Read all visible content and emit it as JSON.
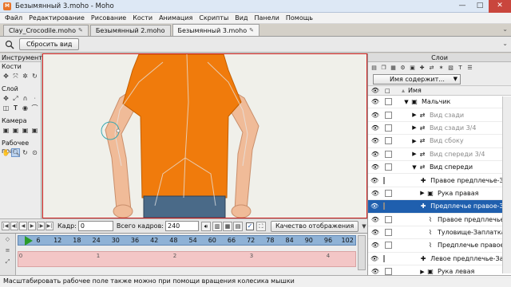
{
  "window": {
    "title": "Безымянный 3.moho - Moho",
    "logo_text": "M"
  },
  "menu": [
    "Файл",
    "Редактирование",
    "Рисование",
    "Кости",
    "Анимация",
    "Скрипты",
    "Вид",
    "Панели",
    "Помощь"
  ],
  "tabs": [
    {
      "label": "Clay_Crocodile.moho"
    },
    {
      "label": "Безымянный 2.moho"
    },
    {
      "label": "Безымянный 3.moho"
    }
  ],
  "toolbar": {
    "reset_view_label": "Сбросить вид"
  },
  "tools": {
    "header": "Инструменты",
    "groups": [
      {
        "label": "Кости",
        "icons": [
          "bone-select-icon",
          "bone-translate-icon",
          "bone-scale-icon",
          "bone-rotate-icon"
        ]
      },
      {
        "label": "Слой",
        "icons": [
          "layer-translate-icon",
          "layer-scale-icon",
          "layer-rotate-icon",
          "layer-shear-icon",
          "layer-flip-icon",
          "layer-text-icon",
          "layer-eye-icon",
          "layer-curve-icon"
        ]
      },
      {
        "label": "Камера",
        "icons": [
          "camera-track-icon",
          "camera-zoom-icon",
          "camera-roll-icon",
          "camera-pan-icon"
        ]
      },
      {
        "label": "Рабочее поле",
        "icons": [
          "hand-pan-icon",
          "zoom-tool-icon",
          "rotate-view-icon",
          "orbit-icon"
        ]
      }
    ]
  },
  "playbar": {
    "frame_label": "Кадр:",
    "frame_value": "0",
    "total_label": "Всего кадров:",
    "total_value": "240",
    "check_mark": "✓",
    "quality_label": "Качество отображения"
  },
  "timeline": {
    "ticks": [
      "0",
      "6",
      "12",
      "18",
      "24",
      "30",
      "36",
      "42",
      "48",
      "54",
      "60",
      "66",
      "72",
      "78",
      "84",
      "90",
      "96",
      "102"
    ],
    "track_numbers": [
      "0",
      "1",
      "2",
      "3",
      "4"
    ]
  },
  "status": "Масштабировать рабочее поле также можно при помощи вращения колесика мышки",
  "layers": {
    "header": "Слои",
    "filter_label": "Имя содержит...",
    "column_name": "Имя",
    "rows": [
      {
        "name": "Мальчик",
        "depth": 0,
        "expand": "▼",
        "type": "group",
        "dim": false,
        "selected": false
      },
      {
        "name": "Вид сзади",
        "depth": 1,
        "expand": "▶",
        "type": "switch",
        "dim": true,
        "selected": false
      },
      {
        "name": "Вид сзади 3/4",
        "depth": 1,
        "expand": "▶",
        "type": "switch",
        "dim": true,
        "selected": false
      },
      {
        "name": "Вид сбоку",
        "depth": 1,
        "expand": "▶",
        "type": "switch",
        "dim": true,
        "selected": false
      },
      {
        "name": "Вид спереди 3/4",
        "depth": 1,
        "expand": "▶",
        "type": "switch",
        "dim": true,
        "selected": false
      },
      {
        "name": "Вид спереди",
        "depth": 1,
        "expand": "▼",
        "type": "switch",
        "dim": false,
        "selected": false
      },
      {
        "name": "Правое предплечье-Запл",
        "depth": 2,
        "expand": "",
        "type": "bone",
        "dim": false,
        "selected": false
      },
      {
        "name": "Рука правая",
        "depth": 2,
        "expand": "▶",
        "type": "group",
        "dim": false,
        "selected": false
      },
      {
        "name": "Предплечье правое-Запл",
        "depth": 2,
        "expand": "",
        "type": "bone",
        "dim": false,
        "selected": true
      },
      {
        "name": "Правое предплечье",
        "depth": 2,
        "expand": "",
        "type": "vector",
        "dim": false,
        "selected": false
      },
      {
        "name": "Туловище-Заплатка",
        "depth": 2,
        "expand": "",
        "type": "vector",
        "dim": false,
        "selected": false
      },
      {
        "name": "Предплечье правое",
        "depth": 2,
        "expand": "",
        "type": "vector",
        "dim": false,
        "selected": false
      },
      {
        "name": "Левое предплечье-Запл",
        "depth": 2,
        "expand": "",
        "type": "bone",
        "dim": false,
        "selected": false
      },
      {
        "name": "Рука левая",
        "depth": 2,
        "expand": "▶",
        "type": "group",
        "dim": false,
        "selected": false
      }
    ]
  },
  "colors": {
    "shirt": "#f07b0c",
    "skin": "#f0bb98",
    "pants": "#4a6a88",
    "accent": "#1f5fae",
    "timeline_ruler": "#8fb2d6",
    "timeline_track": "#f3c6c6"
  }
}
